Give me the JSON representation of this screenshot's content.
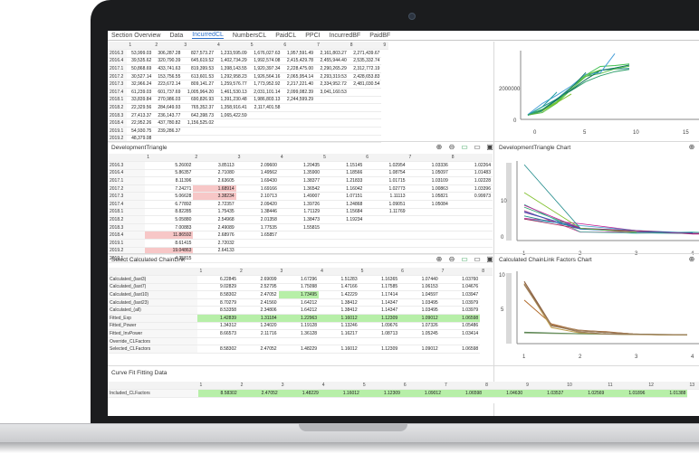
{
  "tabs": [
    "Section Overview",
    "Data",
    "IncurredCL",
    "NumbersCL",
    "PaidCL",
    "PPCI",
    "IncurredBF",
    "PaidBF"
  ],
  "active_tab": "IncurredCL",
  "top_grid": {
    "col_headers": [
      "1",
      "2",
      "3",
      "4",
      "5",
      "6",
      "7",
      "8",
      "9"
    ],
    "rows": [
      {
        "label": "2016.3",
        "cells": [
          "53,999.03",
          "306,287.28",
          "827,573.27",
          "1,233,595.09",
          "1,676,027.63",
          "1,957,591.49",
          "2,161,803.27",
          "2,271,439.67"
        ]
      },
      {
        "label": "2016.4",
        "cells": [
          "39,535.62",
          "320,790.39",
          "645,619.52",
          "1,402,734.29",
          "1,992,574.08",
          "2,415,429.78",
          "2,455,944.40",
          "2,535,332.74"
        ]
      },
      {
        "label": "2017.1",
        "cells": [
          "50,868.69",
          "433,741.63",
          "819,399.53",
          "1,398,143.55",
          "1,920,397.34",
          "2,228,475.00",
          "2,290,265.29",
          "2,312,772.19"
        ]
      },
      {
        "label": "2017.2",
        "cells": [
          "30,527.14",
          "153,756.55",
          "613,601.53",
          "1,292,958.23",
          "1,926,564.16",
          "2,065,954.14",
          "2,293,319.53",
          "2,428,653.83"
        ]
      },
      {
        "label": "2017.3",
        "cells": [
          "32,966.24",
          "223,672.14",
          "809,141.27",
          "1,259,576.77",
          "1,773,952.92",
          "2,217,221.40",
          "2,334,952.72",
          "2,481,030.54"
        ]
      },
      {
        "label": "2017.4",
        "cells": [
          "61,239.03",
          "601,737.69",
          "1,005,964.20",
          "1,461,530.13",
          "2,031,101.14",
          "2,099,082.39",
          "3,041,160.53",
          ""
        ]
      },
      {
        "label": "2018.1",
        "cells": [
          "33,839.84",
          "270,986.03",
          "690,826.93",
          "1,391,230.48",
          "1,986,803.13",
          "2,244,599.29",
          "",
          ""
        ]
      },
      {
        "label": "2018.2",
        "cells": [
          "22,329.56",
          "284,649.93",
          "765,352.37",
          "1,358,916.41",
          "2,117,401.58",
          "",
          "",
          ""
        ]
      },
      {
        "label": "2018.3",
        "cells": [
          "27,413.37",
          "236,143.77",
          "642,398.73",
          "1,065,422.59",
          "",
          "",
          "",
          ""
        ]
      },
      {
        "label": "2018.4",
        "cells": [
          "22,952.26",
          "437,780.82",
          "1,156,525.02",
          "",
          "",
          "",
          "",
          ""
        ]
      },
      {
        "label": "2019.1",
        "cells": [
          "54,930.75",
          "239,286.37",
          "",
          "",
          "",
          "",
          "",
          ""
        ]
      },
      {
        "label": "2019.2",
        "cells": [
          "48,379.08",
          "",
          "",
          "",
          "",
          "",
          "",
          ""
        ]
      }
    ]
  },
  "top_chart": {
    "y_tick": "2000000",
    "y_tick_zero": "0",
    "x_ticks": [
      "0",
      "5",
      "10",
      "15"
    ]
  },
  "dev_triangle": {
    "title": "DevelopmentTriangle",
    "col_headers": [
      "1",
      "2",
      "3",
      "4",
      "5",
      "6",
      "7",
      "8"
    ],
    "rows": [
      {
        "label": "2016.3",
        "cells": [
          "5.26002",
          "3.85113",
          "2.09600",
          "1.20435",
          "1.15145",
          "1.02954",
          "1.03336",
          "1.02264"
        ]
      },
      {
        "label": "2016.4",
        "cells": [
          "5.86357",
          "2.71080",
          "1.49562",
          "1.35900",
          "1.18566",
          "1.08754",
          "1.05097",
          "1.01483"
        ]
      },
      {
        "label": "2017.1",
        "cells": [
          "8.11396",
          "2.63605",
          "1.69430",
          "1.38377",
          "1.21833",
          "1.01715",
          "1.03109",
          "1.02228"
        ]
      },
      {
        "label": "2017.2",
        "cells": [
          "7.24271",
          "1.68914",
          "1.69166",
          "1.36542",
          "1.16042",
          "1.02773",
          "1.00863",
          "1.03396"
        ]
      },
      {
        "label": "2017.3",
        "cells": [
          "5.06628",
          "3.38234",
          "2.10713",
          "1.49007",
          "1.07151",
          "1.11113",
          "1.05821",
          "0.99973"
        ]
      },
      {
        "label": "2017.4",
        "cells": [
          "6.77892",
          "2.72357",
          "2.09420",
          "1.39726",
          "1.24868",
          "1.09051",
          "1.05084",
          ""
        ]
      },
      {
        "label": "2018.1",
        "cells": [
          "8.82285",
          "1.75435",
          "1.38446",
          "1.71129",
          "1.15684",
          "1.11769",
          "",
          ""
        ]
      },
      {
        "label": "2018.2",
        "cells": [
          "5.05880",
          "2.54968",
          "2.01358",
          "1.38473",
          "1.19234",
          "",
          "",
          ""
        ]
      },
      {
        "label": "2018.3",
        "cells": [
          "7.00883",
          "2.49089",
          "1.77535",
          "1.55815",
          "",
          "",
          "",
          ""
        ]
      },
      {
        "label": "2018.4",
        "cells": [
          "11.86592",
          "2.68976",
          "1.65857",
          "",
          "",
          "",
          "",
          ""
        ]
      },
      {
        "label": "2019.1",
        "cells": [
          "8.61415",
          "2.72032",
          "",
          "",
          "",
          "",
          "",
          ""
        ]
      },
      {
        "label": "2019.2",
        "cells": [
          "19.04863",
          "2.64133",
          "",
          "",
          "",
          "",
          "",
          ""
        ]
      },
      {
        "label": "2019.1",
        "cells": [
          "4.35815",
          "",
          "",
          "",
          "",
          "",
          "",
          ""
        ]
      }
    ]
  },
  "dev_chart": {
    "title": "DevelopmentTriangle Chart",
    "y_tick": "10",
    "y_tick_zero": "0",
    "x_ticks": [
      "1",
      "2",
      "3",
      "4"
    ]
  },
  "chainlink": {
    "title": "Select Calculated ChainLink",
    "col_headers": [
      "1",
      "2",
      "3",
      "4",
      "5",
      "6",
      "7",
      "8"
    ],
    "rows": [
      {
        "label": "Calculated_(last3)",
        "cells": [
          "6.22845",
          "2.69099",
          "1.67296",
          "1.51283",
          "1.16365",
          "1.07440",
          "1.03760"
        ],
        "style": ""
      },
      {
        "label": "Calculated_(last7)",
        "cells": [
          "9.02829",
          "2.52795",
          "1.75098",
          "1.47166",
          "1.17585",
          "1.06153",
          "1.04676"
        ],
        "style": ""
      },
      {
        "label": "Calculated_(last10)",
        "cells": [
          "8.58302",
          "2.47052",
          "1.73495",
          "1.42229",
          "1.17414",
          "1.04597",
          "1.03947"
        ],
        "style": "green3"
      },
      {
        "label": "Calculated_(last23)",
        "cells": [
          "8.70279",
          "2.41560",
          "1.64212",
          "1.38412",
          "1.14347",
          "1.03495",
          "1.03979"
        ],
        "style": ""
      },
      {
        "label": "Calculated_(all)",
        "cells": [
          "8.53358",
          "2.34806",
          "1.64212",
          "1.38412",
          "1.14347",
          "1.03495",
          "1.03979"
        ],
        "style": ""
      },
      {
        "label": "Fitted_Exp",
        "cells": [
          "1.42839",
          "1.31184",
          "1.22963",
          "1.16012",
          "1.12309",
          "1.09012",
          "1.06598"
        ],
        "style": "greenrow"
      },
      {
        "label": "Fitted_Power",
        "cells": [
          "1.34312",
          "1.24020",
          "1.19128",
          "1.13246",
          "1.09676",
          "1.07326",
          "1.05486"
        ],
        "style": ""
      },
      {
        "label": "Fitted_InvPower",
        "cells": [
          "8.66573",
          "2.11716",
          "1.36128",
          "1.16217",
          "1.08713",
          "1.05245",
          "1.03414"
        ],
        "style": ""
      },
      {
        "label": "Override_CLFactors",
        "cells": [
          "",
          "",
          "",
          "",
          "",
          "",
          ""
        ],
        "style": ""
      },
      {
        "label": "Selected_CLFactors",
        "cells": [
          "8.58302",
          "2.47052",
          "1.48229",
          "1.16012",
          "1.12309",
          "1.09012",
          "1.06598"
        ],
        "style": ""
      }
    ]
  },
  "cl_chart": {
    "title": "Calculated ChainLink Factors Chart",
    "y_tick_top": "10",
    "y_tick_mid": "5",
    "x_ticks": [
      "1",
      "2",
      "3",
      "4"
    ]
  },
  "curvefit": {
    "title": "Curve Fit Fitting Data",
    "col_headers": [
      "1",
      "2",
      "3",
      "4",
      "5",
      "6",
      "7",
      "8",
      "9",
      "10",
      "11",
      "12",
      "13"
    ],
    "row_label": "Included_CLFactors",
    "cells": [
      "8.58302",
      "2.47052",
      "1.48229",
      "1.16012",
      "1.12309",
      "1.09012",
      "1.06598",
      "1.04630",
      "1.03537",
      "1.02569",
      "1.01896",
      "1.01388"
    ]
  },
  "colors": {
    "accent": "#2a6fc9",
    "pink": "#f7c7c7",
    "green": "#b7efa8"
  }
}
